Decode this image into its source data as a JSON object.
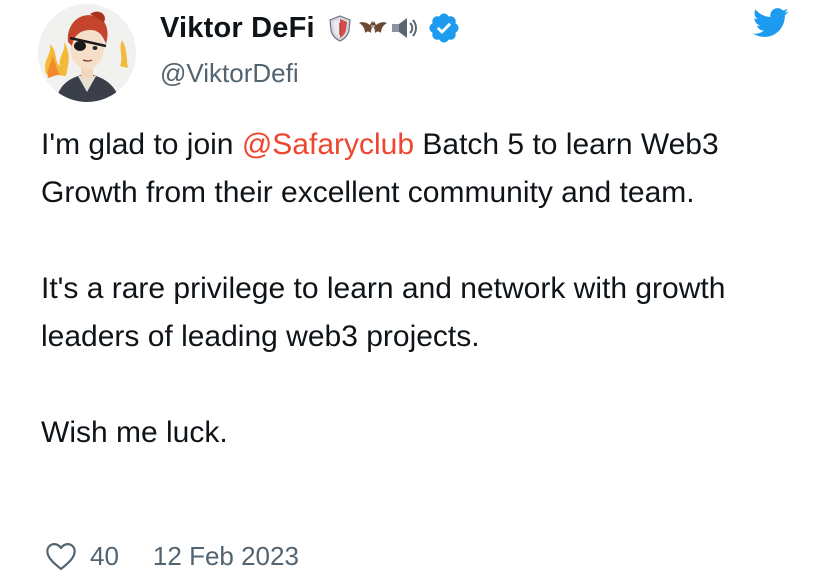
{
  "author": {
    "display_name": "Viktor DeFi",
    "handle": "@ViktorDefi",
    "name_emojis": [
      "shield-emoji",
      "bat-emoji",
      "speaker-emoji"
    ],
    "verified": true
  },
  "tweet": {
    "line1_prefix": "I'm glad to join ",
    "mention": "@Safaryclub",
    "line1_suffix": " Batch 5 to learn Web3 Growth from their excellent community and team.",
    "paragraph2": "It's a rare privilege to learn and network with growth leaders of leading web3 projects.",
    "paragraph3": "Wish me luck."
  },
  "footer": {
    "like_count": "40",
    "date": "12 Feb 2023"
  },
  "colors": {
    "mention": "#f0452e",
    "verified": "#1d9bf0",
    "twitter_bird": "#1d9bf0",
    "secondary_text": "#536471"
  },
  "icons": {
    "brand": "twitter-bird-icon",
    "like": "heart-icon",
    "verified": "verified-badge-icon"
  }
}
